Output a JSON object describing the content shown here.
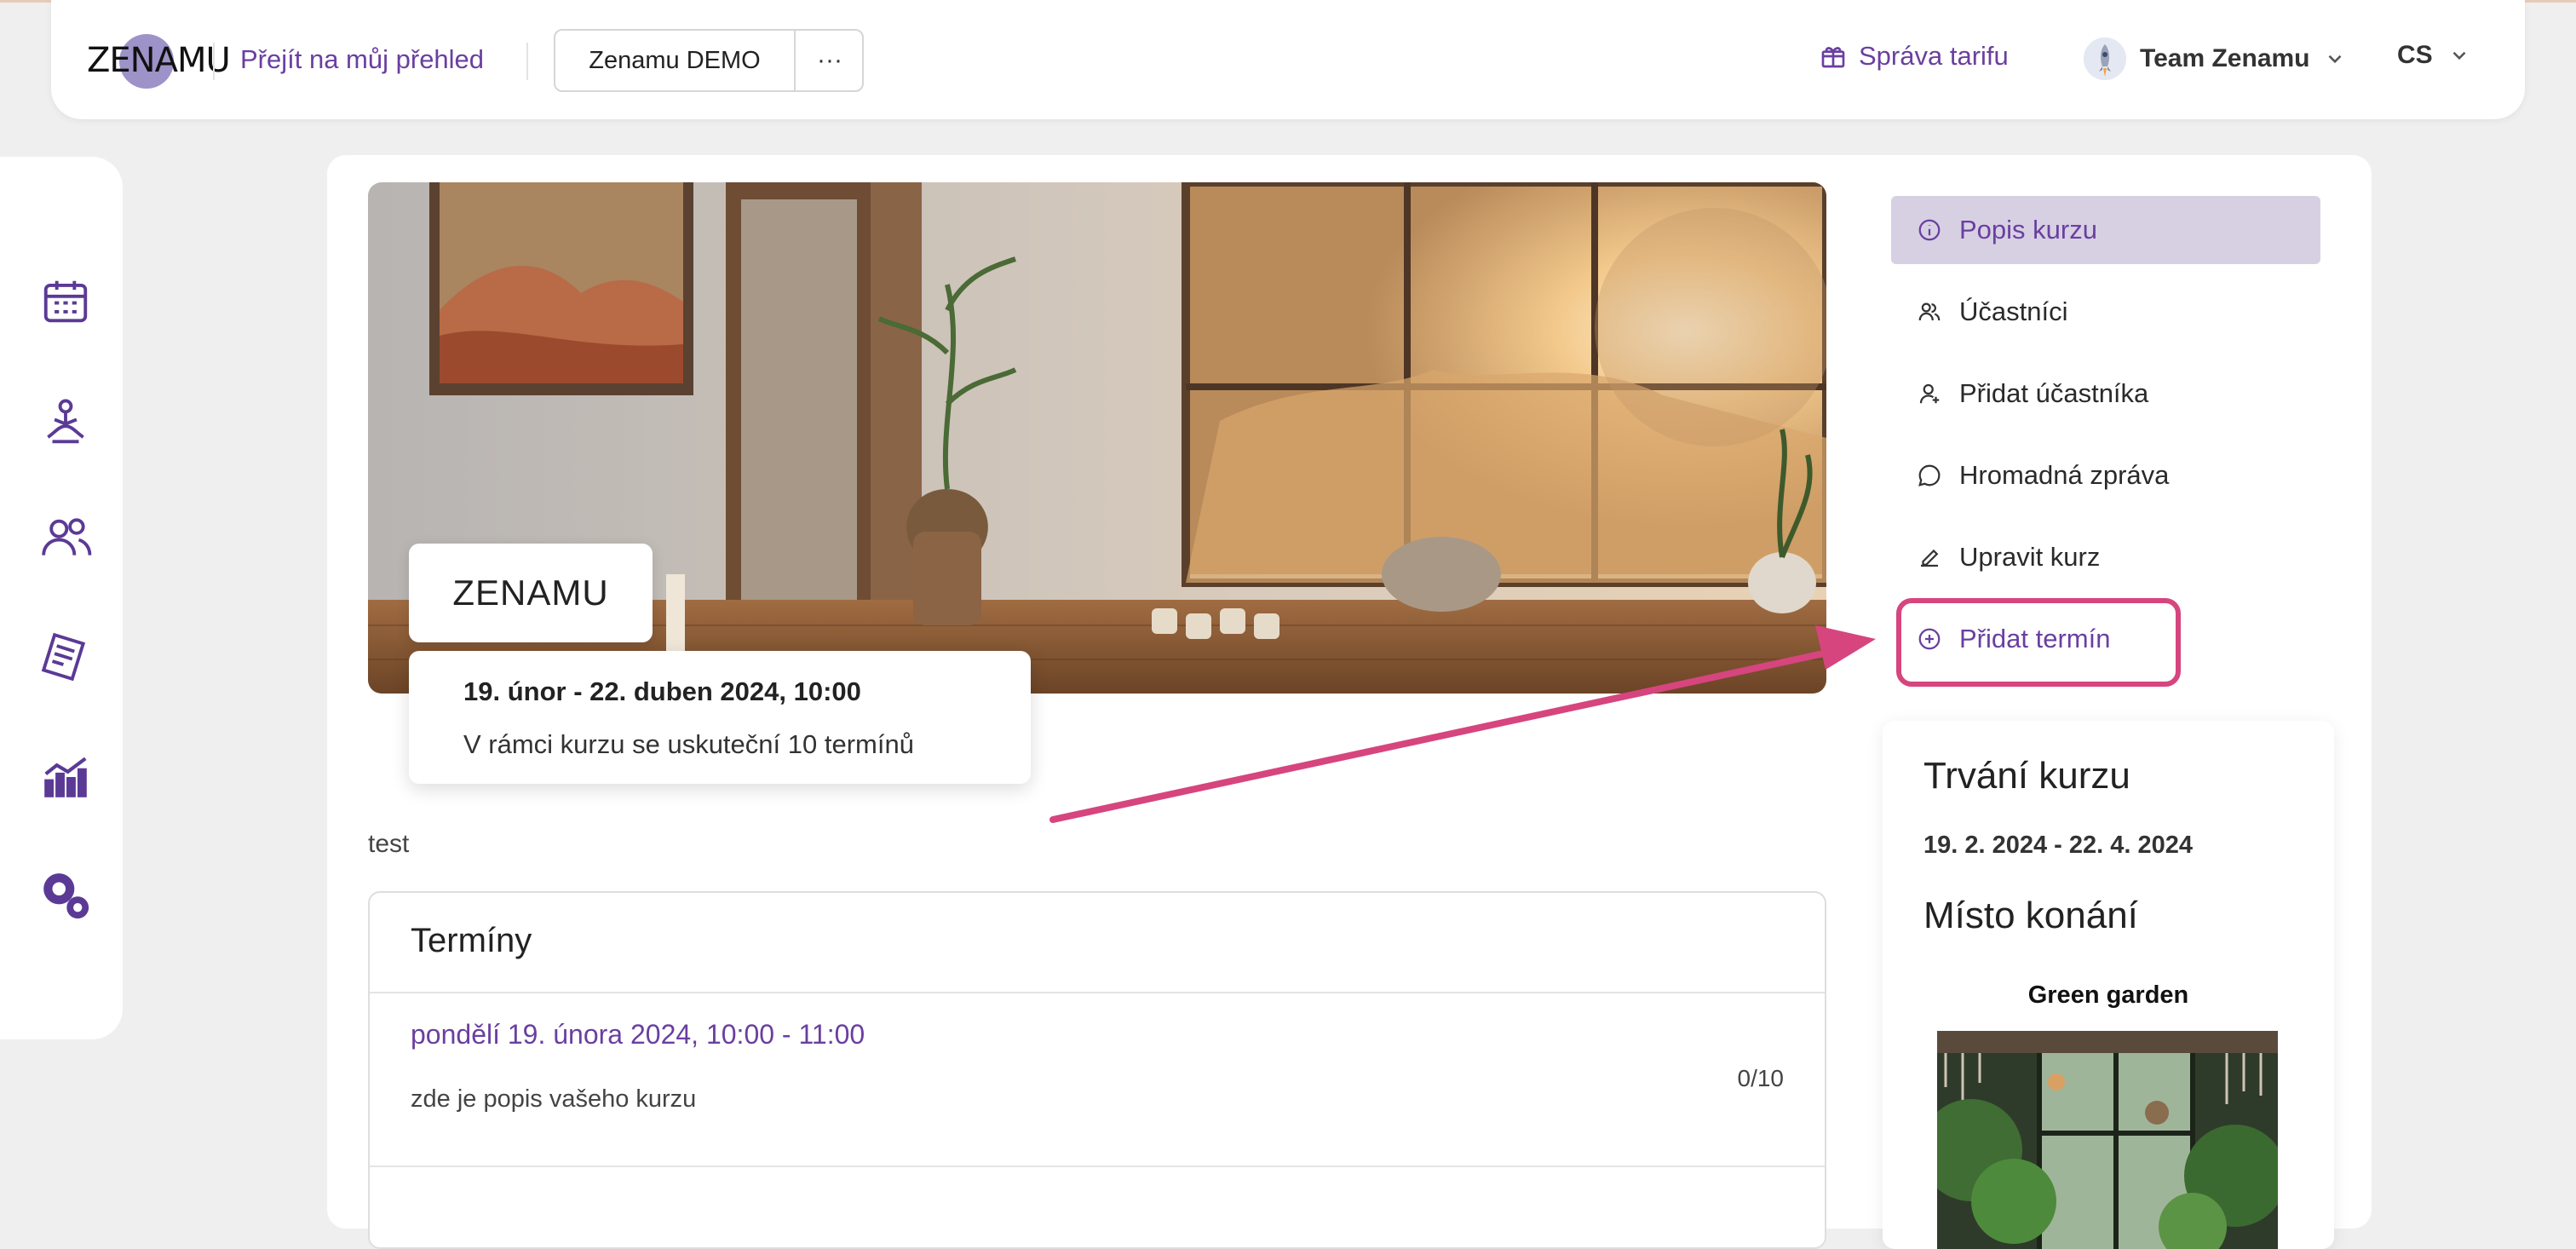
{
  "topbar": {
    "logo_text": "ZENAMU",
    "overview_link": "Přejít na můj přehled",
    "account_button": "Zenamu DEMO",
    "account_more": "···",
    "tariff_link": "Správa tarifu",
    "team_name": "Team Zenamu",
    "language": "CS"
  },
  "sidebar": {
    "items": [
      {
        "icon": "calendar-icon"
      },
      {
        "icon": "meditation-icon"
      },
      {
        "icon": "users-icon"
      },
      {
        "icon": "document-icon"
      },
      {
        "icon": "statistics-icon"
      },
      {
        "icon": "settings-icon"
      }
    ]
  },
  "course": {
    "title": "ZENAMU",
    "date_range": "19. únor - 22. duben 2024, 10:00",
    "sessions_info": "V rámci kurzu se uskuteční 10 termínů",
    "description": "test"
  },
  "terms": {
    "heading": "Termíny",
    "items": [
      {
        "when": "pondělí 19. února 2024, 10:00 - 11:00",
        "description": "zde je popis vašeho kurzu",
        "capacity": "0/10"
      }
    ]
  },
  "menu": {
    "items": [
      {
        "label": "Popis kurzu",
        "icon": "info-icon"
      },
      {
        "label": "Účastníci",
        "icon": "participants-icon"
      },
      {
        "label": "Přidat účastníka",
        "icon": "add-user-icon"
      },
      {
        "label": "Hromadná zpráva",
        "icon": "chat-icon"
      },
      {
        "label": "Upravit kurz",
        "icon": "pencil-icon"
      },
      {
        "label": "Přidat termín",
        "icon": "plus-circle-icon"
      }
    ]
  },
  "info": {
    "duration_heading": "Trvání kurzu",
    "duration_range": "19. 2. 2024 - 22. 4. 2024",
    "location_heading": "Místo konání",
    "location_name": "Green garden"
  },
  "colors": {
    "accent": "#6a3fa0",
    "highlight": "#d6457e",
    "active_menu_bg": "#d7d0e3"
  }
}
